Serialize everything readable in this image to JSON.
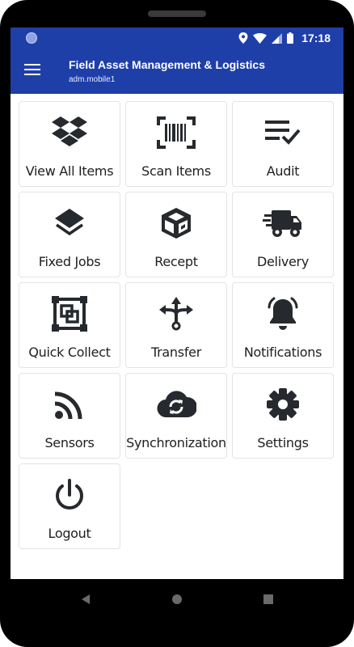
{
  "status": {
    "time": "17:18"
  },
  "appbar": {
    "title": "Field Asset Management & Logistics",
    "user": "adm.mobile1"
  },
  "menu": [
    {
      "label": "View All Items",
      "icon": "dropbox-icon"
    },
    {
      "label": "Scan Items",
      "icon": "barcode-icon"
    },
    {
      "label": "Audit",
      "icon": "checklist-icon"
    },
    {
      "label": "Fixed Jobs",
      "icon": "layers-icon"
    },
    {
      "label": "Recept",
      "icon": "box-open-icon"
    },
    {
      "label": "Delivery",
      "icon": "truck-icon"
    },
    {
      "label": "Quick Collect",
      "icon": "object-group-icon"
    },
    {
      "label": "Transfer",
      "icon": "split-arrows-icon"
    },
    {
      "label": "Notifications",
      "icon": "bell-icon"
    },
    {
      "label": "Sensors",
      "icon": "rss-icon"
    },
    {
      "label": "Synchronization",
      "icon": "cloud-sync-icon"
    },
    {
      "label": "Settings",
      "icon": "gear-icon"
    },
    {
      "label": "Logout",
      "icon": "power-icon"
    }
  ],
  "colors": {
    "appbar": "#1f3fa8",
    "icon": "#262a2e",
    "tile_border": "#e4e4e4"
  }
}
